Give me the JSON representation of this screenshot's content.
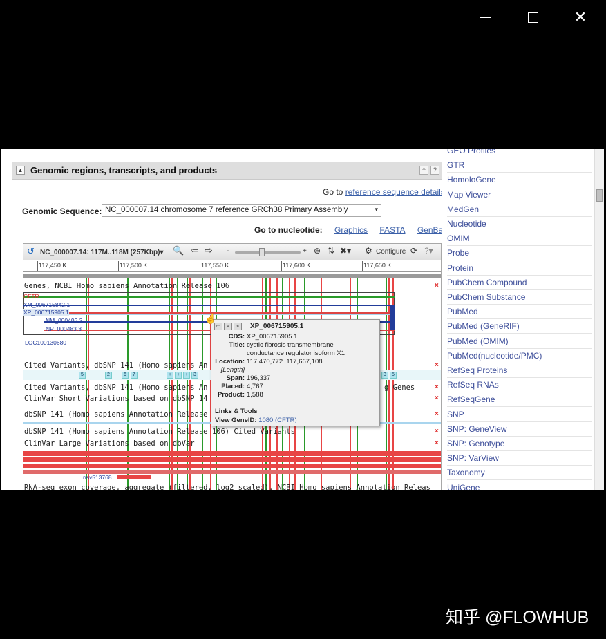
{
  "window": {
    "min_icon": "minimize-icon",
    "max_icon": "maximize-icon",
    "close_icon": "close-icon",
    "close_label": "✕"
  },
  "section": {
    "title": "Genomic regions, transcripts, and products",
    "collapse_glyph": "▲",
    "help_glyph": "?",
    "up_glyph": "^"
  },
  "goto_ref": {
    "prefix": "Go to ",
    "link": "reference sequence details"
  },
  "genomic_sequence": {
    "label": "Genomic Sequence:",
    "value": "NC_000007.14 chromosome 7 reference GRCh38 Primary Assembly",
    "arrow": "▾"
  },
  "goto_nucleotide": {
    "label": "Go to nucleotide:",
    "links": [
      "Graphics",
      "FASTA",
      "GenBank"
    ]
  },
  "viewer": {
    "seq_label": "NC_000007.14: 117M..118M (257Kbp)",
    "seq_arrow": "▾",
    "zoom_minus": "-",
    "zoom_plus": "+",
    "configure": "Configure",
    "ruler": [
      "117,450 K",
      "117,500 K",
      "117,550 K",
      "117,600 K",
      "117,650 K"
    ],
    "tracks": [
      "Genes, NCBI Homo sapiens Annotation Release 106",
      "Cited Variants, dbSNP 141 (Homo sapiens An",
      "Cited Variants, dbSNP 141 (Homo sapiens An",
      "ClinVar Short Variations based on dbSNP 14",
      "dbSNP 141 (Homo sapiens Annotation Release",
      "dbSNP 141 (Homo sapiens Annotation Release 106) Cited Variants",
      "ClinVar Large Variations based on dbVar",
      "RNA-seq exon coverage, aggregate (filtered, log2 scaled), NCBI Homo sapiens Annotation Releas"
    ],
    "track_tail": "g Genes",
    "features": {
      "cftr": "CFTR",
      "xm": "XM_006715842.1",
      "xp": "XP_006715905.1",
      "nm": "NM_000492.3",
      "np": "NP_000483.3",
      "loc": "LOC100130680",
      "nsv": "nsv513768"
    },
    "variant_boxes": [
      "5",
      "2",
      "6",
      "7",
      "+",
      "+",
      "+",
      "3",
      "3",
      "5"
    ],
    "close_glyph": "×"
  },
  "popup": {
    "title": "XP_006715905.1",
    "rows": [
      {
        "k": "CDS:",
        "v": "XP_006715905.1"
      },
      {
        "k": "Title:",
        "v": "cystic fibrosis transmembrane"
      },
      {
        "k": "",
        "v": "conductance regulator isoform X1"
      },
      {
        "k": "Location:",
        "v": "117,470,772..117,667,108"
      },
      {
        "k": "[Length]",
        "v": ""
      },
      {
        "k": "Span:",
        "v": "196,337"
      },
      {
        "k": "Placed:",
        "v": "4,767"
      },
      {
        "k": "Product:",
        "v": "1,588"
      }
    ],
    "links_tools": "Links & Tools",
    "geneid_label": "View GeneID:",
    "geneid_link": "1080 (CFTR)"
  },
  "sidebar": {
    "items": [
      "GEO Profiles",
      "GTR",
      "HomoloGene",
      "Map Viewer",
      "MedGen",
      "Nucleotide",
      "OMIM",
      "Probe",
      "Protein",
      "PubChem Compound",
      "PubChem Substance",
      "PubMed",
      "PubMed (GeneRIF)",
      "PubMed (OMIM)",
      "PubMed(nucleotide/PMC)",
      "RefSeq Proteins",
      "RefSeq RNAs",
      "RefSeqGene",
      "SNP",
      "SNP: GeneView",
      "SNP: Genotype",
      "SNP: VarView",
      "Taxonomy",
      "UniGene"
    ]
  },
  "watermark": "知乎 @FLOWHUB",
  "colors": {
    "link": "#3a5fa8",
    "track_red": "#e84545",
    "track_green": "#2a9a2a",
    "feature_blue": "#223c9a"
  }
}
